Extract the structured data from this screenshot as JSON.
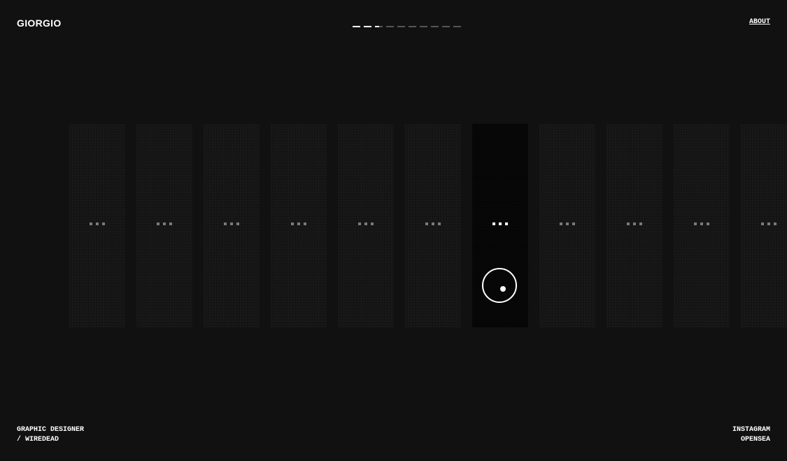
{
  "header": {
    "logo": "GIORGIO",
    "about_link": "ABOUT"
  },
  "progress": {
    "total": 10,
    "filled": 2.5
  },
  "strip": {
    "card_count": 11,
    "active_index": 6,
    "card_glyph": "..."
  },
  "footer": {
    "role_line_1": "GRAPHIC DESIGNER",
    "role_line_2": "/ WIREDEAD",
    "link_1": "INSTAGRAM",
    "link_2": "OPENSEA"
  },
  "colors": {
    "background": "#111111",
    "card": "#161616",
    "card_active": "#050505",
    "text": "#ffffff",
    "muted": "#555555"
  },
  "icons": {
    "cursor": "circle-cursor-icon",
    "card_marker": "ellipsis-icon"
  }
}
